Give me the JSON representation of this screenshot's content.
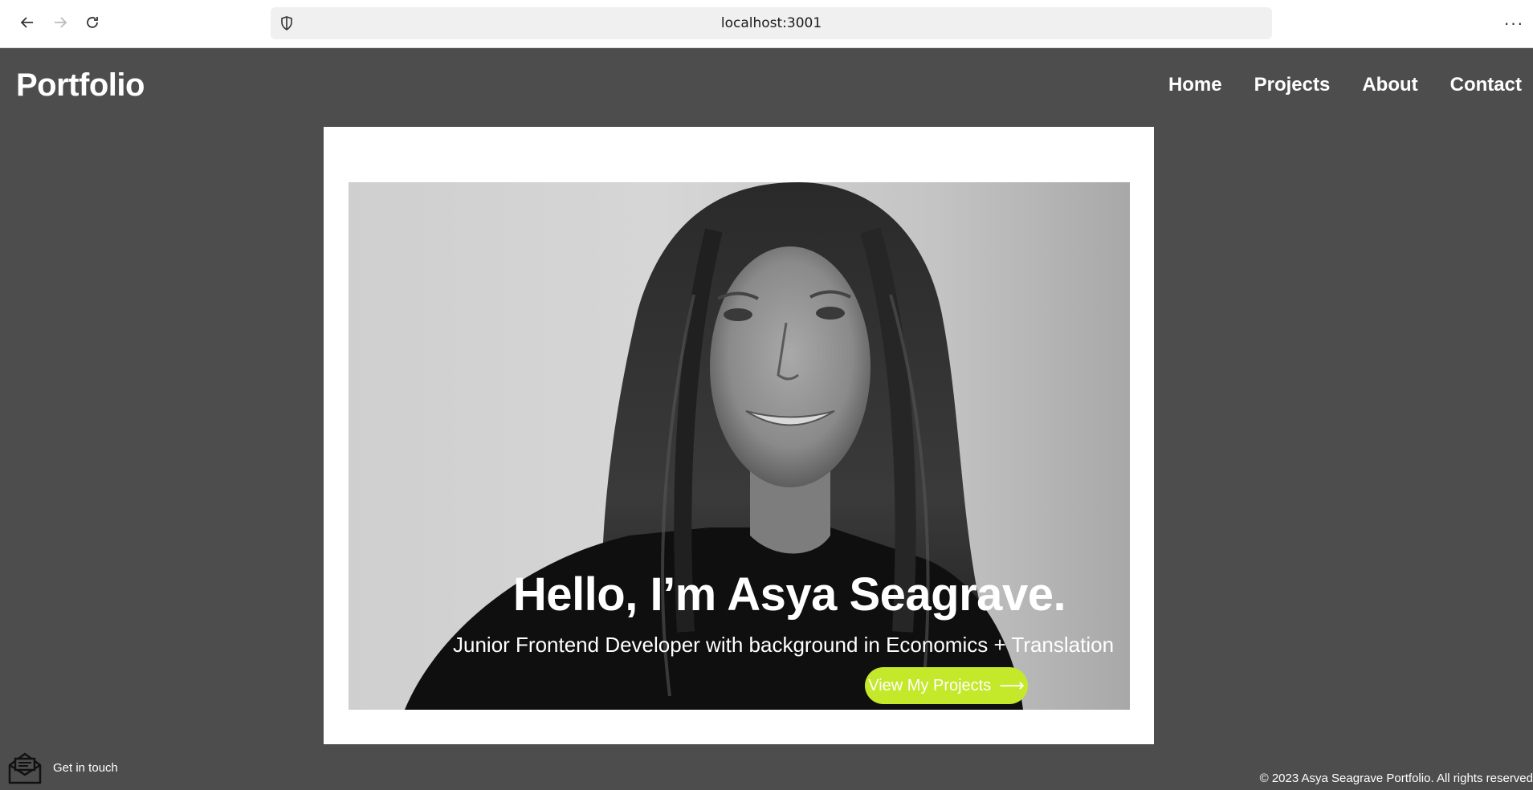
{
  "browser": {
    "url": "localhost:3001",
    "icons": [
      "back-arrow-icon",
      "forward-arrow-icon",
      "reload-icon",
      "shield-icon",
      "more-menu-icon"
    ]
  },
  "header": {
    "brand": "Portfolio",
    "nav": [
      "Home",
      "Projects",
      "About",
      "Contact"
    ]
  },
  "hero": {
    "title": "Hello, I’m Asya Seagrave.",
    "subtitle": "Junior Frontend Developer with background in Economics + Translation",
    "cta_label": "View My Projects",
    "cta_icon": "arrow-right-icon",
    "image": "black-and-white portrait photo"
  },
  "footer": {
    "contact_label": "Get in touch",
    "contact_icon": "mail-icon",
    "copyright": "© 2023 Asya Seagrave Portfolio. All rights reserved"
  },
  "colors": {
    "page_bg": "#4d4d4d",
    "card_bg": "#ffffff",
    "accent": "#c4e82a"
  }
}
